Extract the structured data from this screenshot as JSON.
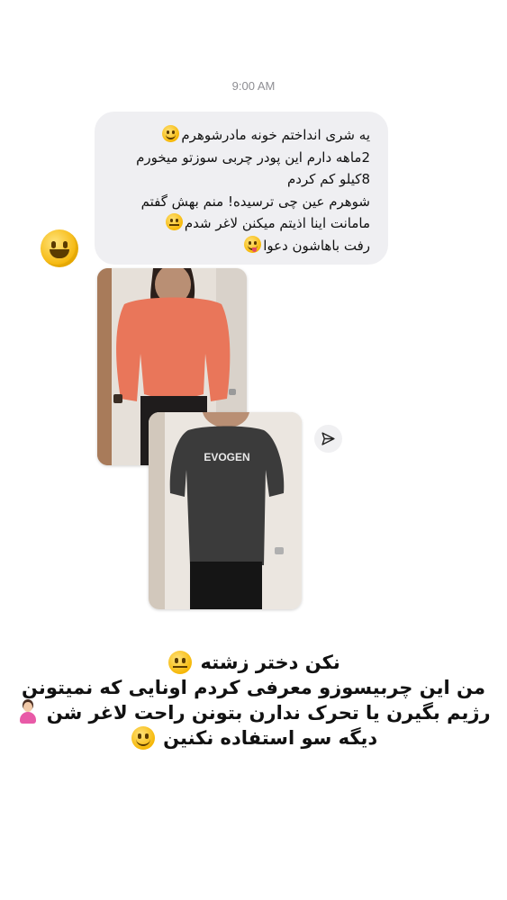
{
  "timestamp": "9:00 AM",
  "message": {
    "lines": [
      "یه شری انداختم خونه مادرشوهرم",
      "2ماهه دارم این پودر چربی سوزتو میخورم",
      "8کیلو کم کردم",
      "شوهرم عین چی ترسیده! منم بهش گفتم",
      "مامانت اینا اذیتم میکنن لاغر شدم",
      "رفت باهاشون دعوا"
    ],
    "reaction_icon": "grinning-face-emoji"
  },
  "photos": {
    "before_alt": "before-photo",
    "after_alt": "after-photo",
    "shirt_text": "EVOGEN",
    "before_shirt_color": "#e9765a",
    "after_shirt_color": "#3b3b3b"
  },
  "share_icon": "paper-plane-icon",
  "caption": {
    "lines": [
      "نکن دختر زشته",
      "من این چربیسوزو معرفی کردم اونایی که نمیتونن",
      "رژیم بگیرن یا تحرک ندارن بتونن راحت لاغر شن",
      "دیگه سو استفاده نکنین"
    ]
  },
  "colors": {
    "bubble_bg": "#efeff2",
    "timestamp": "#8e8e93",
    "text": "#111111"
  }
}
